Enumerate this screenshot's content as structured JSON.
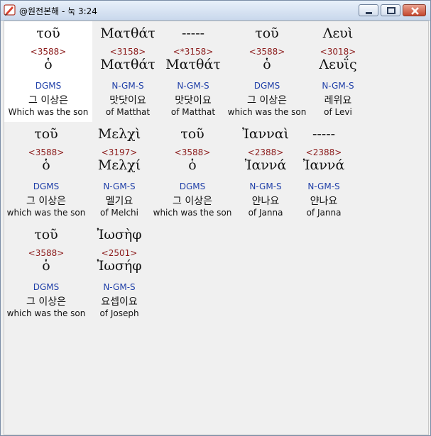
{
  "window": {
    "title": "@원전본해 - 눅 3:24"
  },
  "rows": [
    {
      "cells": [
        {
          "greek": "τοῦ",
          "num": "<3588>",
          "lemma": "ὁ",
          "parse": "DGMS",
          "korean": "그 이상은",
          "english": "Which was the son"
        },
        {
          "greek": "Ματθάτ",
          "num": "<3158>",
          "lemma": "Ματθάτ",
          "parse": "N-GM-S",
          "korean": "맛닷이요",
          "english": "of Matthat"
        },
        {
          "greek": "-----",
          "num": "<*3158>",
          "lemma": "Ματθάτ",
          "parse": "N-GM-S",
          "korean": "맛닷이요",
          "english": "of Matthat"
        },
        {
          "greek": "τοῦ",
          "num": "<3588>",
          "lemma": "ὁ",
          "parse": "DGMS",
          "korean": "그 이상은",
          "english": "which was the son"
        },
        {
          "greek": "Λευὶ",
          "num": "<3018>",
          "lemma": "Λευΐς",
          "parse": "N-GM-S",
          "korean": "레위요",
          "english": "of Levi"
        }
      ]
    },
    {
      "cells": [
        {
          "greek": "τοῦ",
          "num": "<3588>",
          "lemma": "ὁ",
          "parse": "DGMS",
          "korean": "그 이상은",
          "english": "which was the son"
        },
        {
          "greek": "Μελχὶ",
          "num": "<3197>",
          "lemma": "Μελχί",
          "parse": "N-GM-S",
          "korean": "멜기요",
          "english": "of Melchi"
        },
        {
          "greek": "τοῦ",
          "num": "<3588>",
          "lemma": "ὁ",
          "parse": "DGMS",
          "korean": "그 이상은",
          "english": "which was the son"
        },
        {
          "greek": "Ἰανναὶ",
          "num": "<2388>",
          "lemma": "Ἰαννά",
          "parse": "N-GM-S",
          "korean": "얀나요",
          "english": "of Janna"
        },
        {
          "greek": "-----",
          "num": "<2388>",
          "lemma": "Ἰαννά",
          "parse": "N-GM-S",
          "korean": "얀나요",
          "english": "of Janna"
        }
      ]
    },
    {
      "cells": [
        {
          "greek": "τοῦ",
          "num": "<3588>",
          "lemma": "ὁ",
          "parse": "DGMS",
          "korean": "그 이상은",
          "english": "which was the son"
        },
        {
          "greek": "Ἰωσὴφ",
          "num": "<2501>",
          "lemma": "Ἰωσήφ",
          "parse": "N-GM-S",
          "korean": "요셉이요",
          "english": "of Joseph"
        }
      ]
    }
  ]
}
